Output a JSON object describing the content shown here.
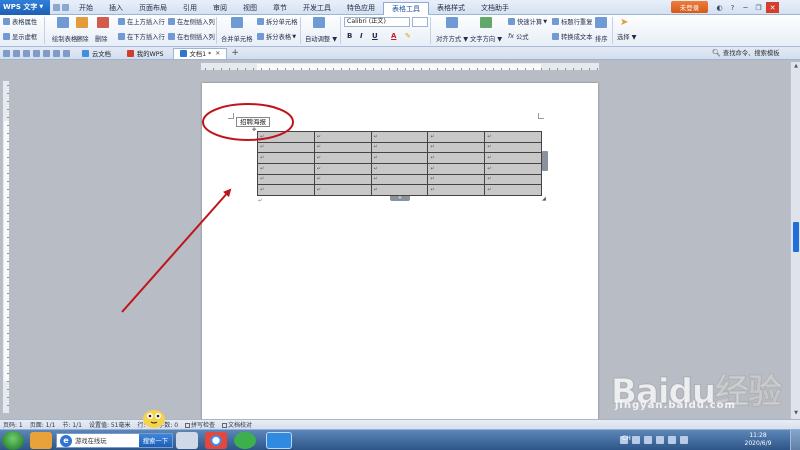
{
  "titlebar": {
    "app_name": "WPS 文字",
    "menu": [
      "开始",
      "插入",
      "页面布局",
      "引用",
      "审阅",
      "视图",
      "章节",
      "开发工具",
      "特色应用",
      "表格工具",
      "表格样式",
      "文档助手"
    ],
    "active_menu_index": 9,
    "login_label": "未登录"
  },
  "ribbon": {
    "table_props": "表格属性",
    "show_gridlines": "显示虚框",
    "draw_table": "绘制表格",
    "erase": "擦除",
    "delete": "删除",
    "insert_above": "在上方插入行",
    "insert_below": "在下方插入行",
    "insert_left": "在左侧插入列",
    "insert_right": "在右侧插入列",
    "merge_cells": "合并单元格",
    "split_cells": "拆分单元格",
    "split_table": "拆分表格",
    "auto_fit": "自动调整",
    "font_name": "Calibri (正文)",
    "bold": "B",
    "italic": "I",
    "underline": "U",
    "font_color": "A",
    "align": "对齐方式",
    "text_direction": "文字方向",
    "formula": "公式",
    "quick_calc": "快速计算",
    "repeat_header": "标题行重复",
    "convert_text": "转换成文本",
    "sort": "排序",
    "select": "选择"
  },
  "tabs": {
    "items": [
      {
        "label": "云文档"
      },
      {
        "label": "我的WPS"
      },
      {
        "label": "文档1 *"
      }
    ],
    "active_index": 2,
    "search_placeholder": "查找命令、搜索模板"
  },
  "document": {
    "tooltip": "招聘海报",
    "table": {
      "rows": 6,
      "cols": 5,
      "cell_mark": "↵"
    },
    "paragraph_mark": "↵"
  },
  "statusbar": {
    "page": "页码: 1",
    "pages": "页面: 1/1",
    "section": "节: 1/1",
    "position": "设置值: 51毫米",
    "row": "行: 6",
    "words": "字数: 0",
    "spell_check": "拼写检查",
    "doc_check": "文档校对"
  },
  "taskbar": {
    "search_placeholder": "游戏在线玩",
    "search_button": "搜索一下",
    "lang": "CH",
    "time": "11:28",
    "date": "2020/6/9"
  },
  "watermark": {
    "brand": "Baidu经验",
    "url": "jingyan.baidu.com"
  },
  "colors": {
    "accent": "#1e6fd9",
    "annotation": "#c0141c",
    "login": "#e86a2a",
    "table_fill": "#c8c8c8"
  }
}
